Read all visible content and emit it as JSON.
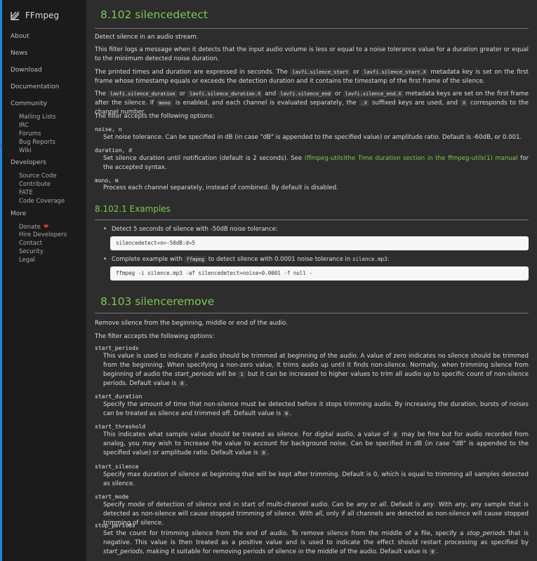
{
  "sidebar": {
    "logo": "FFmpeg",
    "items": [
      "About",
      "News",
      "Download",
      "Documentation",
      "Community",
      "Developers",
      "More"
    ],
    "community": [
      "Mailing Lists",
      "IRC",
      "Forums",
      "Bug Reports",
      "Wiki"
    ],
    "developers": [
      "Source Code",
      "Contribute",
      "FATE",
      "Code Coverage"
    ],
    "more": [
      "Donate",
      "Hire Developers",
      "Contact",
      "Security",
      "Legal"
    ]
  },
  "main": {
    "silencedetect": {
      "title": "8.102 silencedetect",
      "intro": "Detect silence in an audio stream.",
      "p1": "This filter logs a message when it detects that the input audio volume is less or equal to a noise tolerance value for a duration greater or equal to the minimum detected noise duration.",
      "p2a": "The printed times and duration are expressed in seconds. The",
      "code_start": "lavfi.silence_start",
      "or1": "or",
      "code_startx": "lavfi.silence_start.X",
      "p2b": "metadata key is set on the first frame whose timestamp equals or exceeds the detection duration and it contains the timestamp of the first frame of the silence.",
      "p3a": "The",
      "code_duration": "lavfi.silence_duration",
      "or2": "or",
      "code_durationx": "lavfi.silence_duration.X",
      "and1": "and",
      "code_end": "lavfi.silence_end",
      "or3": "or",
      "code_endx": "lavfi.silence_end.X",
      "p3b": "metadata keys are set on the first frame after the silence. If",
      "code_mono": "mono",
      "p3c": "is enabled, and each channel is evaluated separately, the",
      "code_x": ".X",
      "p3d": "suffixed keys are used, and",
      "code_X": "X",
      "p3e": "corresponds to the channel number.",
      "accepts": "The filter accepts the following options:",
      "opt1_name": "noise, n",
      "opt1_desc": "Set noise tolerance. Can be specified in dB (in case \"dB\" is appended to the specified value) or amplitude ratio. Default is -60dB, or 0.001.",
      "opt2_name": "duration, d",
      "opt2_desc_a": "Set silence duration until notification (default is 2 seconds). See",
      "opt2_link": "(ffmpeg-utils)the Time duration section in the ffmpeg-utils(1) manual",
      "opt2_desc_b": "for the accepted syntax.",
      "opt3_name": "mono, m",
      "opt3_desc": "Process each channel separately, instead of combined. By default is disabled.",
      "examples_title": "8.102.1 Examples",
      "ex1_text": "Detect 5 seconds of silence with -50dB noise tolerance:",
      "ex1_code": "silencedetect=n=-50dB:d=5",
      "ex2_text_a": "Complete example with",
      "ex2_code_inline": "ffmpeg",
      "ex2_text_b": "to detect silence with 0.0001 noise tolerance in",
      "ex2_file": "silence.mp3",
      "ex2_text_c": ":",
      "ex2_code": "ffmpeg -i silence.mp3 -af silencedetect=noise=0.0001 -f null -"
    },
    "silenceremove": {
      "title": "8.103 silenceremove",
      "intro": "Remove silence from the beginning, middle or end of the audio.",
      "accepts": "The filter accepts the following options:",
      "start_periods_name": "start_periods",
      "start_periods_a": "This value is used to indicate if audio should be trimmed at beginning of the audio. A value of zero indicates no silence should be trimmed from the beginning. When specifying a non-zero value, it trims audio up until it finds non-silence. Normally, when trimming silence from beginning of audio the",
      "start_periods_em": "start_periods",
      "start_periods_b": "will be",
      "start_periods_code1": "1",
      "start_periods_c": "but it can be increased to higher values to trim all audio up to specific count of non-silence periods. Default value is",
      "start_periods_code0": "0",
      "start_duration_name": "start_duration",
      "start_duration_desc": "Specify the amount of time that non-silence must be detected before it stops trimming audio. By increasing the duration, bursts of noises can be treated as silence and trimmed off. Default value is",
      "start_duration_code": "0",
      "start_threshold_name": "start_threshold",
      "start_threshold_a": "This indicates what sample value should be treated as silence. For digital audio, a value of",
      "start_threshold_code": "0",
      "start_threshold_b": "may be fine but for audio recorded from analog, you may wish to increase the value to account for background noise. Can be specified in dB (in case \"dB\" is appended to the specified value) or amplitude ratio. Default value is",
      "start_threshold_code2": "0",
      "start_silence_name": "start_silence",
      "start_silence_desc": "Specify max duration of silence at beginning that will be kept after trimming. Default is 0, which is equal to trimming all samples detected as silence.",
      "start_mode_name": "start_mode",
      "start_mode_a": "Specify mode of detection of silence end in start of multi-channel audio. Can be",
      "start_mode_any": "any",
      "start_mode_or": "or",
      "start_mode_all": "all",
      "start_mode_b": ". Default is",
      "start_mode_any2": "any",
      "start_mode_c": ". With",
      "start_mode_any3": "any",
      "start_mode_d": ", any sample that is detected as non-silence will cause stopped trimming of silence. With",
      "start_mode_all2": "all",
      "start_mode_e": ", only if all channels are detected as non-silence will cause stopped trimming of silence.",
      "stop_periods_name": "stop_periods",
      "stop_periods_a": "Set the count for trimming silence from the end of audio. To remove silence from the middle of a file, specify a",
      "stop_periods_em": "stop_periods",
      "stop_periods_b": "that is negative. This value is then treated as a positive value and is used to indicate the effect should restart processing as specified by",
      "stop_periods_em2": "start_periods",
      "stop_periods_c": ", making it suitable for removing periods of silence in the middle of the audio. Default value is",
      "stop_periods_code": "0"
    }
  }
}
